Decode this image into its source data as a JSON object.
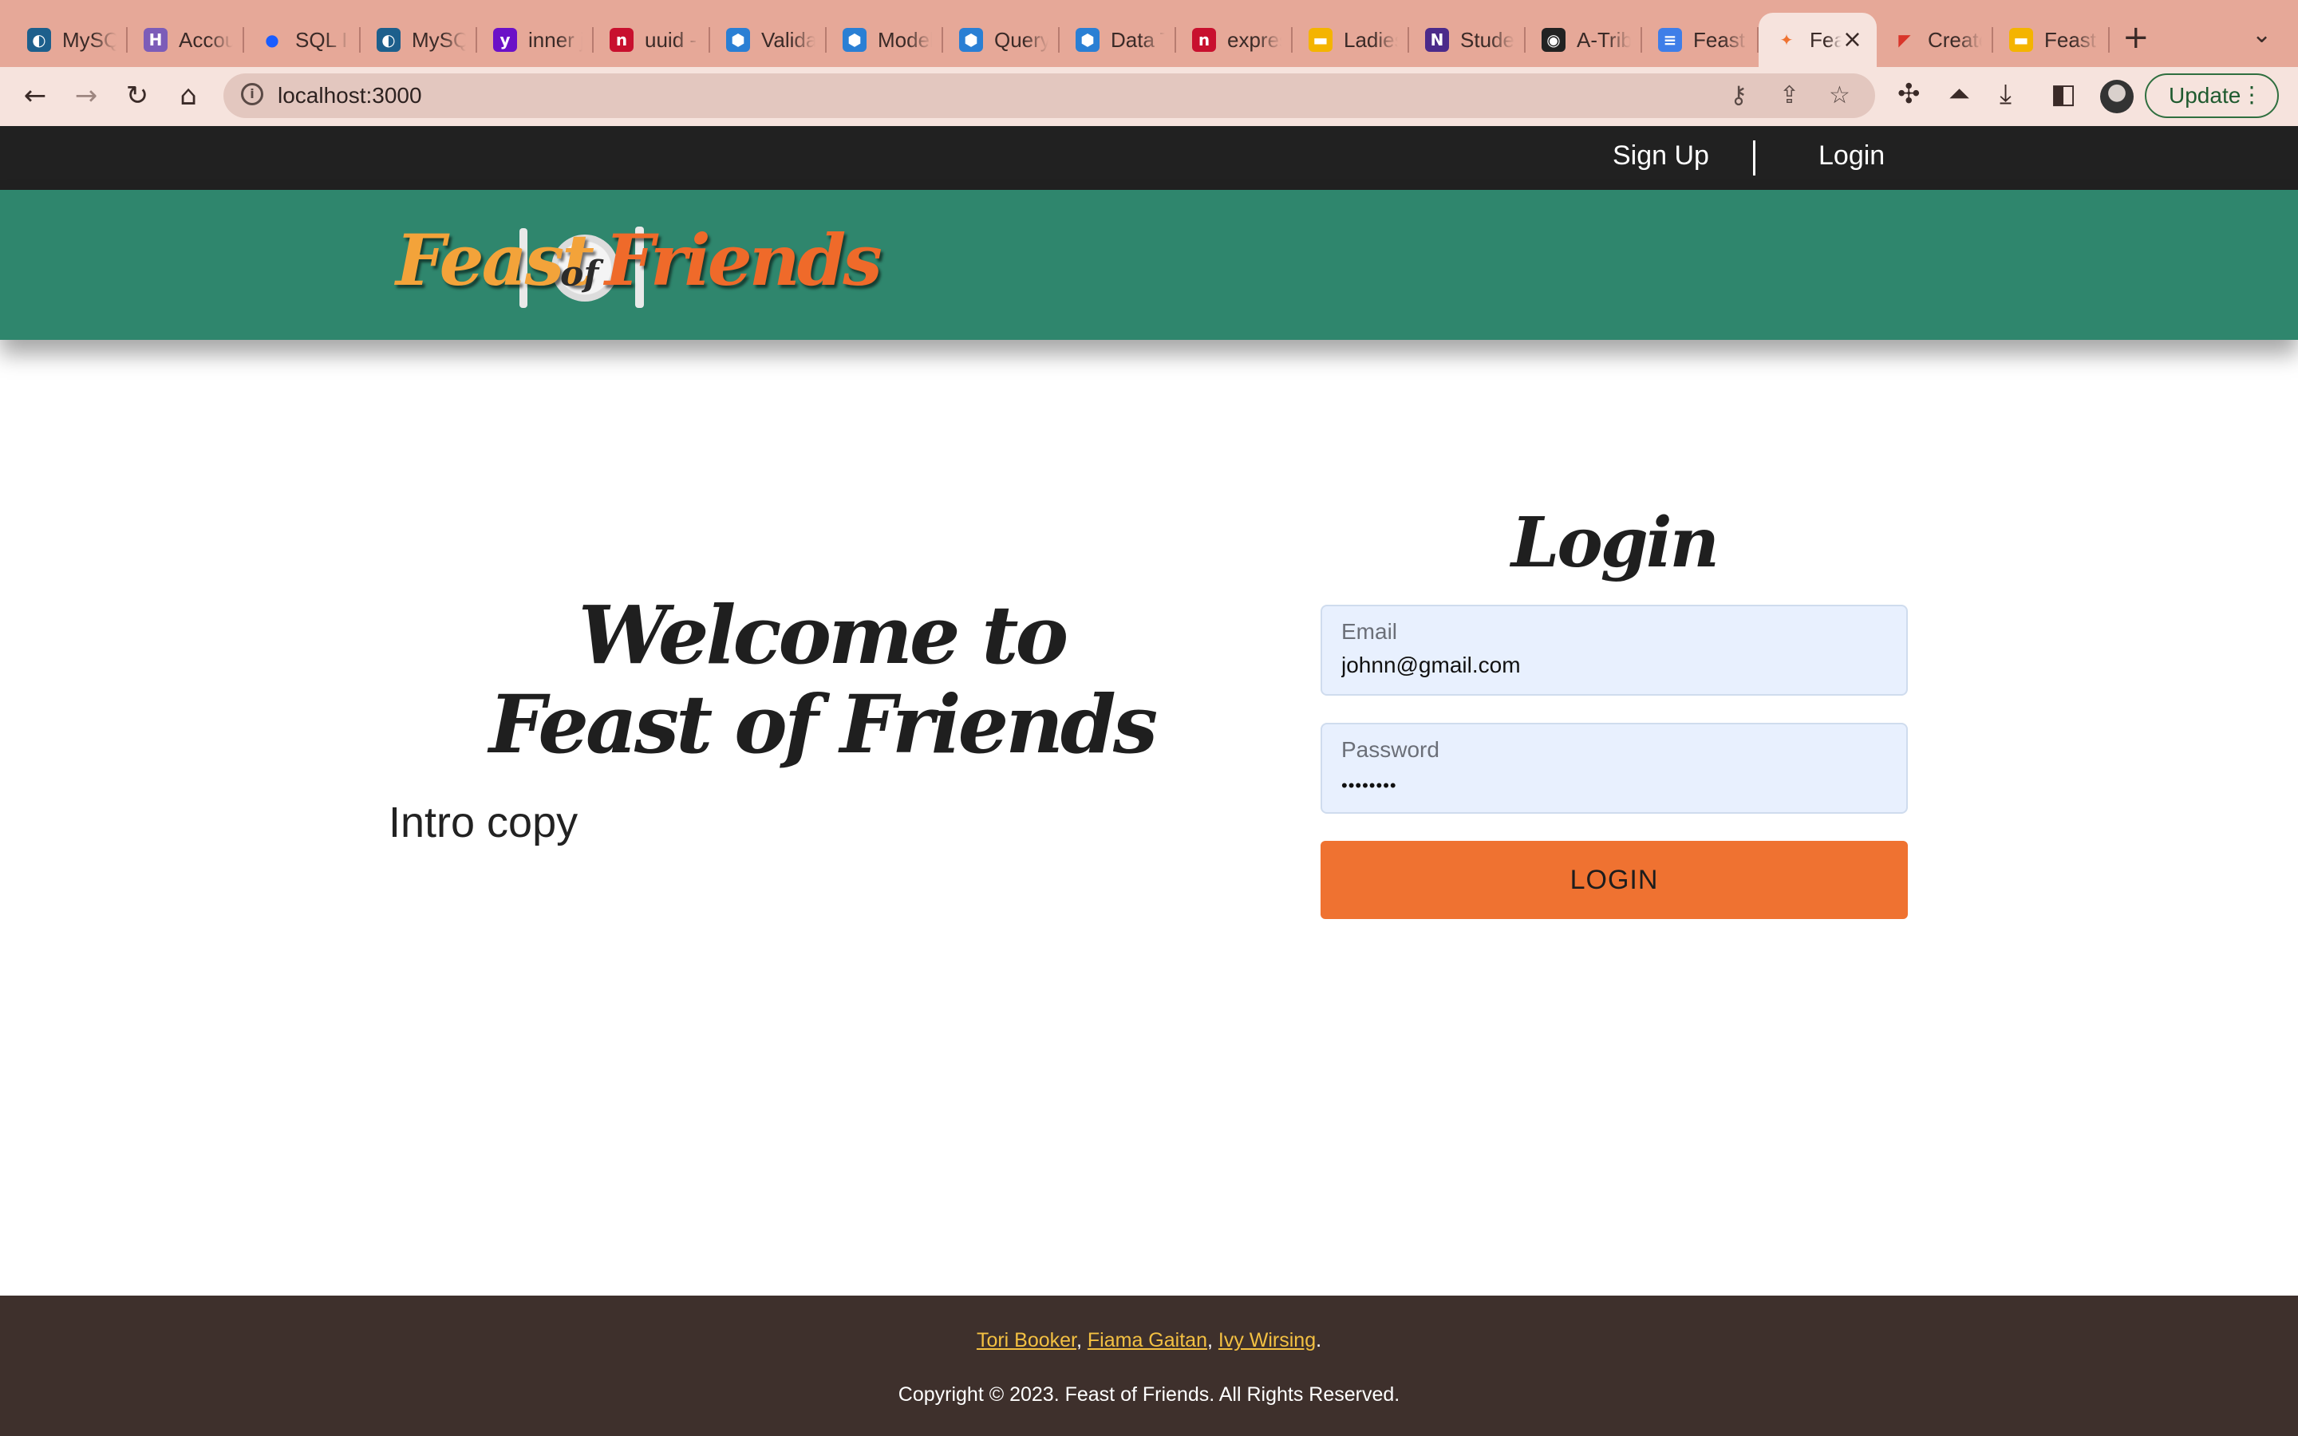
{
  "browser": {
    "tabs": [
      {
        "title": "MySQL",
        "icon": "mysql-icon",
        "color": "#1d5f8c"
      },
      {
        "title": "Account",
        "icon": "heroku-icon",
        "color": "#7c5cb8"
      },
      {
        "title": "SQL INNER",
        "icon": "dot-icon",
        "color": "#1a5cff"
      },
      {
        "title": "MySQL",
        "icon": "mysql-icon",
        "color": "#1d5f8c"
      },
      {
        "title": "inner join",
        "icon": "yahoo-icon",
        "color": "#6b11c7"
      },
      {
        "title": "uuid - npm",
        "icon": "npm-icon",
        "color": "#c8102e"
      },
      {
        "title": "Validations",
        "icon": "sequelize-icon",
        "color": "#2a7fd4"
      },
      {
        "title": "Model",
        "icon": "sequelize-icon",
        "color": "#2a7fd4"
      },
      {
        "title": "Query",
        "icon": "sequelize-icon",
        "color": "#2a7fd4"
      },
      {
        "title": "Data Types",
        "icon": "sequelize-icon",
        "color": "#2a7fd4"
      },
      {
        "title": "express",
        "icon": "npm-icon",
        "color": "#c8102e"
      },
      {
        "title": "Ladies",
        "icon": "slides-icon",
        "color": "#f4b400"
      },
      {
        "title": "Student",
        "icon": "notion-icon",
        "color": "#4b2a8a"
      },
      {
        "title": "A-Tribe",
        "icon": "github-icon",
        "color": "#222222"
      },
      {
        "title": "Feast",
        "icon": "docs-icon",
        "color": "#3f7ee8"
      },
      {
        "title": "Feast of Friends",
        "icon": "feast-favicon-icon",
        "color": "#ef7231",
        "active": true
      },
      {
        "title": "Create",
        "icon": "create-icon",
        "color": "#d9352a"
      },
      {
        "title": "Feast",
        "icon": "slides-icon",
        "color": "#f4b400"
      }
    ],
    "url": "localhost:3000",
    "update_label": "Update"
  },
  "nav": {
    "signup": "Sign Up",
    "login": "Login"
  },
  "brand": {
    "feast": "Feast",
    "of": "of",
    "friends": "Friends",
    "colors": {
      "feast": "#f3a33a",
      "friends": "#ef6a2a",
      "banner": "#2f866d"
    }
  },
  "hero": {
    "line1": "Welcome to",
    "line2": "Feast of Friends",
    "intro": "Intro copy"
  },
  "login_form": {
    "title": "Login",
    "email_label": "Email",
    "email_value": "johnn@gmail.com",
    "password_label": "Password",
    "password_value": "••••••••",
    "submit": "LOGIN"
  },
  "footer": {
    "authors": [
      "Tori Booker",
      "Fiama Gaitan",
      "Ivy Wirsing"
    ],
    "copyright": "Copyright © 2023. Feast of Friends. All Rights Reserved."
  }
}
